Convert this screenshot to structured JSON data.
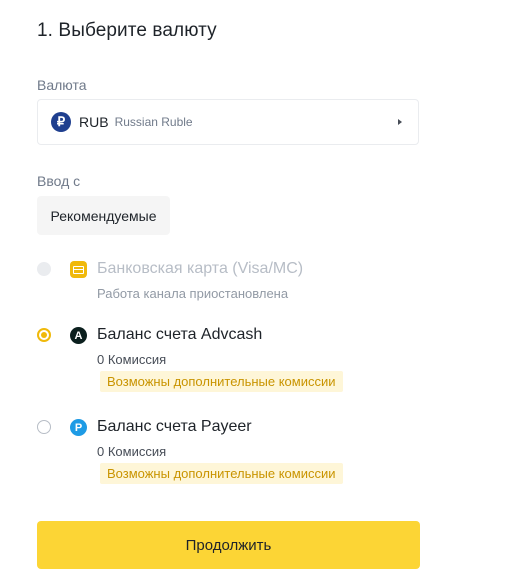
{
  "step_title": "1. Выберите валюту",
  "currency": {
    "label": "Валюта",
    "icon_symbol": "₽",
    "code": "RUB",
    "name": "Russian Ruble"
  },
  "input": {
    "label": "Ввод с",
    "tab_label": "Рекомендуемые"
  },
  "methods": [
    {
      "icon": "credit-card-icon",
      "title": "Банковская карта (Visa/MC)",
      "subtitle": "Работа канала приостановлена",
      "state": "disabled"
    },
    {
      "icon": "advcash-icon",
      "icon_symbol": "A",
      "title": "Баланс счета Advcash",
      "subtitle": "0 Комиссия",
      "badge": "Возможны дополнительные комиссии",
      "state": "selected"
    },
    {
      "icon": "payeer-icon",
      "icon_symbol": "P",
      "title": "Баланс счета Payeer",
      "subtitle": "0 Комиссия",
      "badge": "Возможны дополнительные комиссии",
      "state": "unselected"
    }
  ],
  "continue_label": "Продолжить",
  "colors": {
    "accent": "#f0b90b",
    "button": "#fcd535",
    "badge_bg": "#fef6d8",
    "badge_text": "#c99400"
  }
}
